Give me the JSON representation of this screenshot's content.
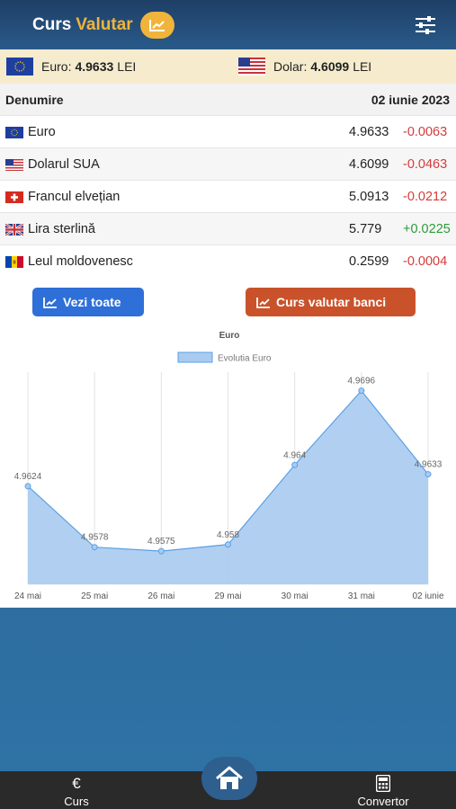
{
  "header": {
    "logo_primary": "Curs",
    "logo_secondary": "Valutar",
    "brand_color": "#f0b43c"
  },
  "rate_bar": {
    "euro_label": "Euro:",
    "euro_value": "4.9633",
    "euro_unit": "LEI",
    "dolar_label": "Dolar:",
    "dolar_value": "4.6099",
    "dolar_unit": "LEI"
  },
  "table": {
    "header_name": "Denumire",
    "header_date": "02 iunie 2023",
    "rows": [
      {
        "name": "Euro",
        "value": "4.9633",
        "change": "-0.0063",
        "trend": "neg",
        "flag": "eu-flag"
      },
      {
        "name": "Dolarul SUA",
        "value": "4.6099",
        "change": "-0.0463",
        "trend": "neg",
        "flag": "us-flag"
      },
      {
        "name": "Francul elvețian",
        "value": "5.0913",
        "change": "-0.0212",
        "trend": "neg",
        "flag": "ch-flag"
      },
      {
        "name": "Lira sterlină",
        "value": "5.779",
        "change": "+0.0225",
        "trend": "pos",
        "flag": "gb-flag"
      },
      {
        "name": "Leul moldovenesc",
        "value": "0.2599",
        "change": "-0.0004",
        "trend": "neg",
        "flag": "md-flag"
      }
    ]
  },
  "buttons": {
    "vezi_toate": "Vezi toate",
    "curs_banci": "Curs valutar banci"
  },
  "chart_data": {
    "type": "area",
    "title": "Euro",
    "legend": "Evolutia Euro",
    "legend_position": "top",
    "categories": [
      "24 mai",
      "25 mai",
      "26 mai",
      "29 mai",
      "30 mai",
      "31 mai",
      "02 iunie"
    ],
    "series": [
      {
        "name": "Evolutia Euro",
        "values": [
          4.9624,
          4.9578,
          4.9575,
          4.958,
          4.964,
          4.9696,
          4.9633
        ]
      }
    ],
    "value_labels": [
      "4.9624",
      "4.9578",
      "4.9575",
      "4.958",
      "4.964",
      "4.9696",
      "4.9633"
    ],
    "ylim": [
      4.955,
      4.971
    ],
    "grid": "vertical",
    "fill_color": "#a9cbf0",
    "line_color": "#5aa0e6"
  },
  "bottom_nav": {
    "curs_label": "Curs",
    "curs_icon": "euro-icon",
    "home_icon": "home-icon",
    "convertor_label": "Convertor",
    "convertor_icon": "calculator-icon"
  }
}
